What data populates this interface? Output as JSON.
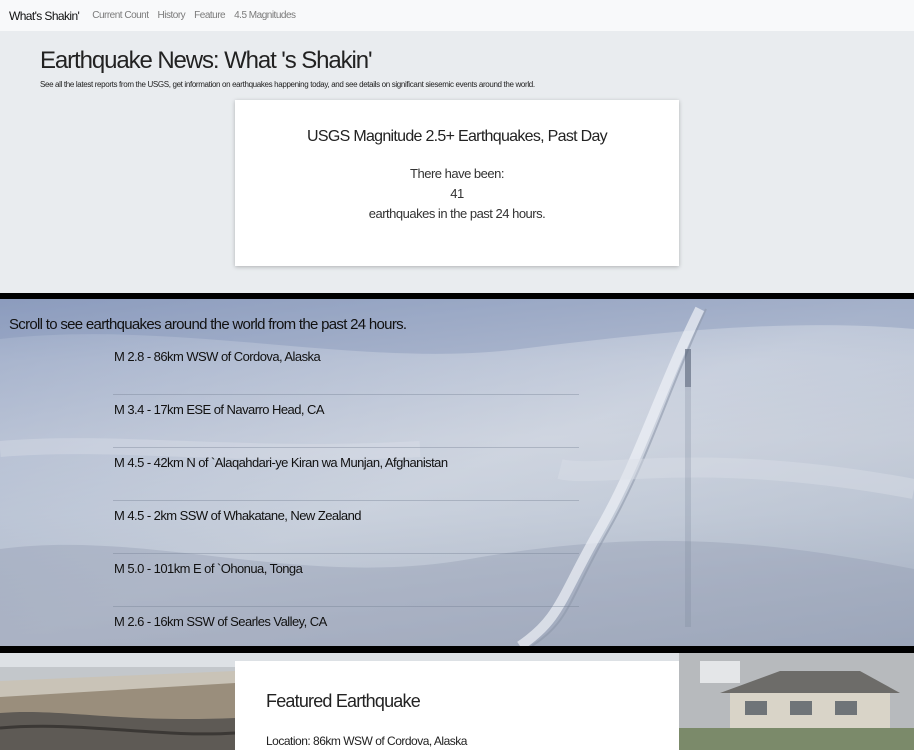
{
  "navbar": {
    "brand": "What's Shakin'",
    "links": [
      "Current Count",
      "History",
      "Feature",
      "4.5 Magnitudes"
    ]
  },
  "jumbotron": {
    "title": "Earthquake News: What 's Shakin'",
    "lead": "See all the latest reports from the USGS, get information on earthquakes happening today, and see details on significant siesemic events around the world.",
    "card": {
      "title": "USGS Magnitude 2.5+ Earthquakes, Past Day",
      "line1": "There have been:",
      "count": "41",
      "line2": "earthquakes in the past 24 hours."
    }
  },
  "scroll_section": {
    "heading": "Scroll to see earthquakes around the world from the past 24 hours.",
    "items": [
      "M 2.8 - 86km WSW of Cordova, Alaska",
      "M 3.4 - 17km ESE of Navarro Head, CA",
      "M 4.5 - 42km N of `Alaqahdari-ye Kiran wa Munjan, Afghanistan",
      "M 4.5 - 2km SSW of Whakatane, New Zealand",
      "M 5.0 - 101km E of `Ohonua, Tonga",
      "M 2.6 - 16km SSW of Searles Valley, CA"
    ]
  },
  "featured": {
    "title": "Featured Earthquake",
    "location": "Location: 86km WSW of Cordova, Alaska"
  },
  "colors": {
    "navbar_bg": "#f8f9fa",
    "jumbotron_bg": "#e9ecef",
    "separator": "#000000",
    "card_bg": "#ffffff"
  }
}
